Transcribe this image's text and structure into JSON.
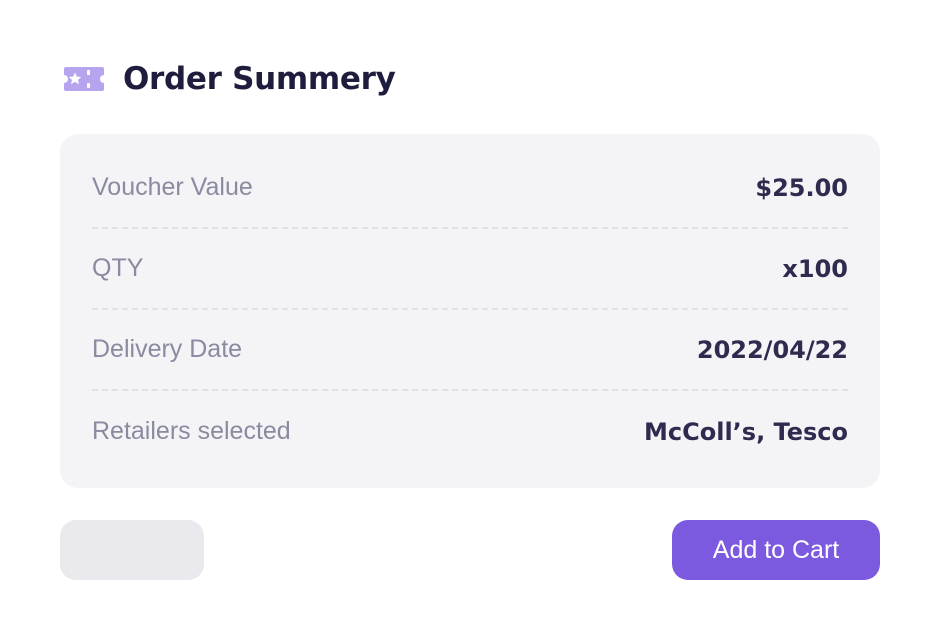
{
  "header": {
    "icon": "ticket-star-icon",
    "title": "Order Summery"
  },
  "summary": {
    "rows": [
      {
        "label": "Voucher Value",
        "value": "$25.00"
      },
      {
        "label": "QTY",
        "value": "x100"
      },
      {
        "label": "Delivery Date",
        "value": "2022/04/22"
      },
      {
        "label": "Retailers selected",
        "value": "McColl’s, Tesco"
      }
    ]
  },
  "actions": {
    "secondary_label": "",
    "primary_label": "Add to Cart"
  },
  "colors": {
    "accent": "#7b5ae0",
    "icon": "#b7a4ee",
    "title": "#1f1d3d",
    "card_bg": "#f4f4f7"
  }
}
